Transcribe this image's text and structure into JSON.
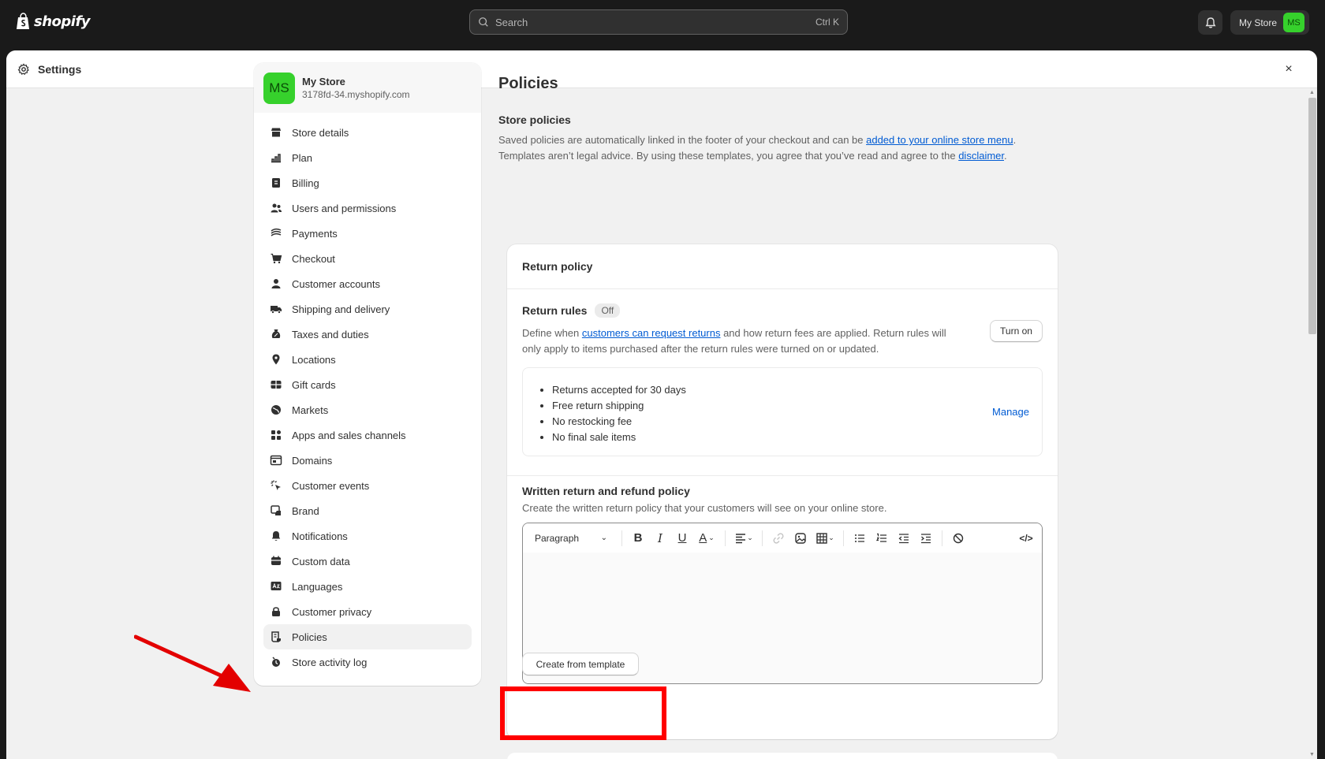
{
  "topbar": {
    "logo_text": "shopify",
    "search_placeholder": "Search",
    "search_shortcut": "Ctrl K",
    "store_button": "My Store",
    "store_initials": "MS"
  },
  "modal": {
    "title": "Settings",
    "close": "×"
  },
  "sidebar": {
    "store_initials": "MS",
    "store_name": "My Store",
    "store_domain": "3178fd-34.myshopify.com",
    "items": [
      {
        "label": "Store details",
        "icon": "store-icon"
      },
      {
        "label": "Plan",
        "icon": "plan-icon"
      },
      {
        "label": "Billing",
        "icon": "billing-icon"
      },
      {
        "label": "Users and permissions",
        "icon": "users-icon"
      },
      {
        "label": "Payments",
        "icon": "payments-icon"
      },
      {
        "label": "Checkout",
        "icon": "cart-icon"
      },
      {
        "label": "Customer accounts",
        "icon": "person-icon"
      },
      {
        "label": "Shipping and delivery",
        "icon": "truck-icon"
      },
      {
        "label": "Taxes and duties",
        "icon": "tax-icon"
      },
      {
        "label": "Locations",
        "icon": "location-icon"
      },
      {
        "label": "Gift cards",
        "icon": "gift-card-icon"
      },
      {
        "label": "Markets",
        "icon": "globe-icon"
      },
      {
        "label": "Apps and sales channels",
        "icon": "apps-icon"
      },
      {
        "label": "Domains",
        "icon": "domains-icon"
      },
      {
        "label": "Customer events",
        "icon": "cursor-icon"
      },
      {
        "label": "Brand",
        "icon": "brand-icon"
      },
      {
        "label": "Notifications",
        "icon": "bell-icon"
      },
      {
        "label": "Custom data",
        "icon": "custom-data-icon"
      },
      {
        "label": "Languages",
        "icon": "language-icon"
      },
      {
        "label": "Customer privacy",
        "icon": "lock-icon"
      },
      {
        "label": "Policies",
        "icon": "policies-icon"
      },
      {
        "label": "Store activity log",
        "icon": "activity-icon"
      }
    ],
    "active_index": 20
  },
  "main": {
    "page_title": "Policies",
    "store_policies_title": "Store policies",
    "desc_part1": "Saved policies are automatically linked in the footer of your checkout and can be ",
    "desc_link1": "added to your online store menu",
    "desc_part2": ". Templates aren’t legal advice. By using these templates, you agree that you’ve read and agree to the ",
    "desc_link2": "disclaimer",
    "desc_part3": "."
  },
  "return_policy": {
    "card_title": "Return policy",
    "rules_title": "Return rules",
    "rules_badge": "Off",
    "rules_desc_part1": "Define when ",
    "rules_desc_link": "customers can request returns",
    "rules_desc_part2": " and how return fees are applied. Return rules will only apply to items purchased after the return rules were turned on or updated.",
    "turn_on_label": "Turn on",
    "rules_list": [
      "Returns accepted for 30 days",
      "Free return shipping",
      "No restocking fee",
      "No final sale items"
    ],
    "manage_label": "Manage",
    "written_title": "Written return and refund policy",
    "written_desc": "Create the written return policy that your customers will see on your online store.",
    "editor_format": "Paragraph",
    "create_template_label": "Create from template"
  },
  "colors": {
    "accent_link": "#005bd3",
    "store_avatar": "#36d12c",
    "annotation": "#ff0000"
  }
}
